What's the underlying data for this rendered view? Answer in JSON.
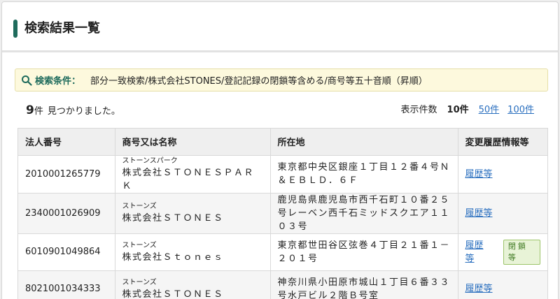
{
  "header": {
    "title": "検索結果一覧"
  },
  "conditions": {
    "label": "検索条件：",
    "text": "部分一致検索/株式会社STONES/登記記録の閉鎖等含める/商号等五十音順（昇順）"
  },
  "results": {
    "count": "9",
    "unit": "件",
    "suffix": "見つかりました。"
  },
  "per_page": {
    "label": "表示件数",
    "current": "10件",
    "options": [
      "50件",
      "100件"
    ]
  },
  "table": {
    "headers": [
      "法人番号",
      "商号又は名称",
      "所在地",
      "変更履歴情報等"
    ],
    "rows": [
      {
        "number": "2010001265779",
        "kana": "ストーンスパーク",
        "name": "株式会社ＳＴＯＮＥＳＰＡＲＫ",
        "address": "東京都中央区銀座１丁目１２番４号Ｎ＆ＥＢＬＤ．６Ｆ",
        "history": "履歴等",
        "badge": ""
      },
      {
        "number": "2340001026909",
        "kana": "ストーンズ",
        "name": "株式会社ＳＴＯＮＥＳ",
        "address": "鹿児島県鹿児島市西千石町１０番２５号レーベン西千石ミッドスクエア１１０３号",
        "history": "履歴等",
        "badge": ""
      },
      {
        "number": "6010901049864",
        "kana": "ストーンズ",
        "name": "株式会社Ｓｔｏｎｅｓ",
        "address": "東京都世田谷区弦巻４丁目２１番１－２０１号",
        "history": "履歴等",
        "badge": "閉鎖等"
      },
      {
        "number": "8021001034333",
        "kana": "ストーンズ",
        "name": "株式会社ＳＴＯＮＥＳ",
        "address": "神奈川県小田原市城山１丁目６番３３号水戸ビル２階Ｂ号室",
        "history": "履歴等",
        "badge": ""
      }
    ]
  },
  "colors": {
    "accent": "#1e6b5c",
    "link": "#2a6fbf",
    "badge_bg": "#e8f3d7",
    "badge_text": "#3f7a22"
  },
  "icons": {
    "conditions": "search-icon"
  }
}
